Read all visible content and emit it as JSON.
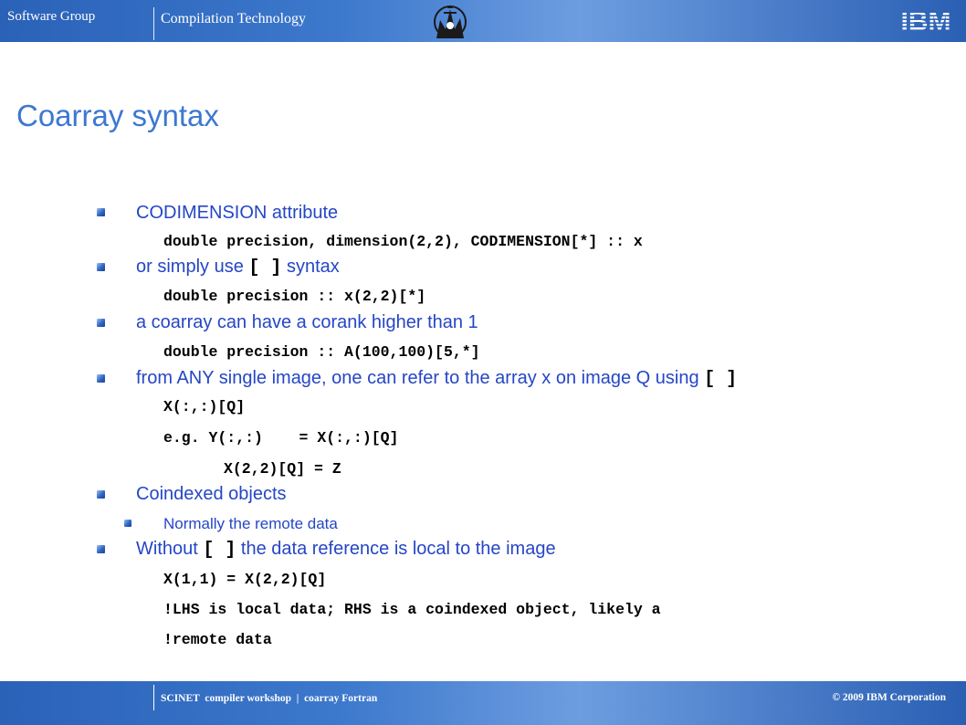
{
  "header": {
    "group": "Software Group",
    "section": "Compilation Technology"
  },
  "title": "Coarray syntax",
  "items": [
    {
      "t1": "CODIMENSION attribute"
    },
    {
      "code": "double precision, dimension(2,2), CODIMENSION[*] :: x"
    },
    {
      "t1_pre": "or simply use ",
      "t1_code": "[ ]",
      "t1_post": " syntax"
    },
    {
      "code": "double precision :: x(2,2)[*]"
    },
    {
      "t1": "a coarray can have a corank higher than 1"
    },
    {
      "code": "double precision :: A(100,100)[5,*]"
    },
    {
      "t1_pre": "from ANY single image, one can refer to the array x on image Q using ",
      "t1_code": "[ ]"
    },
    {
      "code": "X(:,:)[Q]"
    },
    {
      "code": "e.g. Y(:,:)    = X(:,:)[Q]"
    },
    {
      "code": "X(2,2)[Q] = Z"
    },
    {
      "t1": "Coindexed objects"
    },
    {
      "t2": "Normally the remote data"
    },
    {
      "t1_pre": "Without ",
      "t1_code": "[ ]",
      "t1_post": " the data reference is local to the image"
    },
    {
      "code": "X(1,1) = X(2,2)[Q]"
    },
    {
      "code": "!LHS is local data; RHS is a coindexed object, likely a"
    },
    {
      "code": "!remote data"
    }
  ],
  "footer": {
    "left": "SCINET  compiler workshop  |  coarray Fortran",
    "right": "© 2009 IBM Corporation"
  },
  "logo": {
    "text": "IBM",
    "color": "#ffffff"
  },
  "colors": {
    "accent": "#3c78d0",
    "bullet_text": "#2546c6",
    "bar": "#2a62b8"
  }
}
